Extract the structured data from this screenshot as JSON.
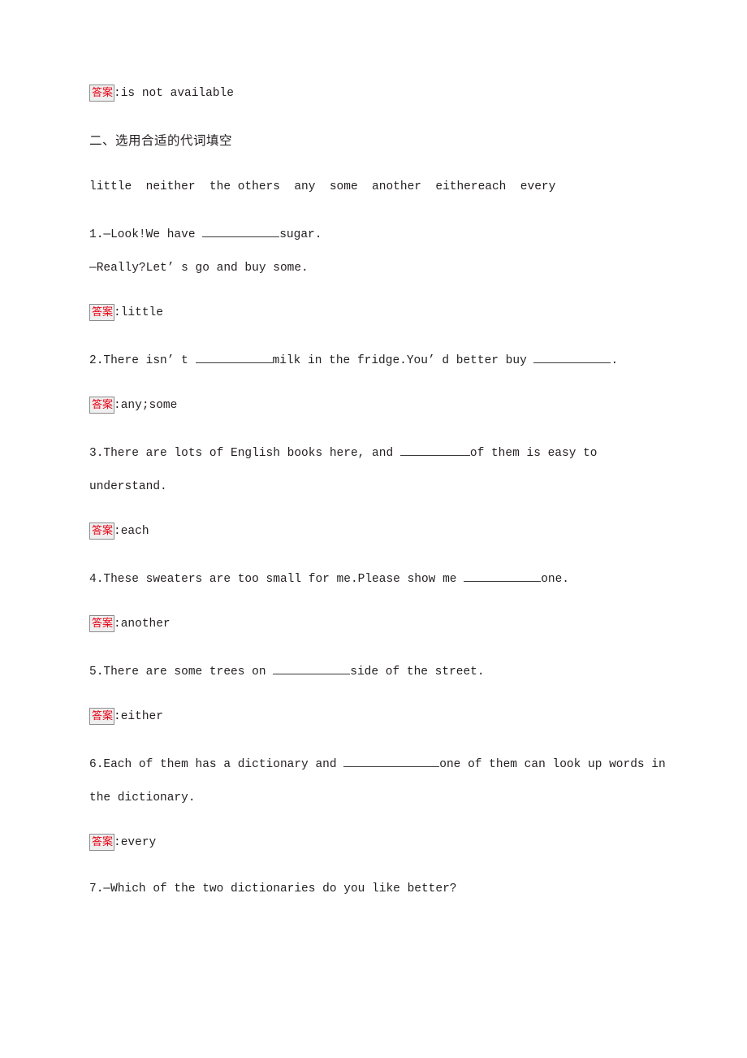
{
  "document": {
    "answer_label": "答案",
    "answer_separator": "：",
    "colors": {
      "answer_red": "#e60012",
      "badge_background": "#efefef",
      "badge_border": "#8c8c8c",
      "body_text": "#231f20"
    }
  },
  "top_answer": {
    "label": "答案",
    "colon": ":",
    "text": "is not available"
  },
  "section": {
    "heading": "二、选用合适的代词填空",
    "word_bank": "little  neither  the others  any  some  another  eithereach  every"
  },
  "questions": [
    {
      "number": "1",
      "lines": [
        {
          "before": "1.—Look!We have ",
          "blank": "md",
          "after": "sugar."
        },
        {
          "before": "—Really?Let’ s go and buy some.",
          "blank": null,
          "after": ""
        }
      ],
      "answer": {
        "label": "答案",
        "colon": ":",
        "text": "little"
      }
    },
    {
      "number": "2",
      "lines": [
        {
          "before": "2.There isn’ t ",
          "blank": "md",
          "after": "milk in the fridge.You’ d better buy ",
          "blank2": "md",
          "after2": "."
        }
      ],
      "answer": {
        "label": "答案",
        "colon": ":",
        "text": "any;some"
      }
    },
    {
      "number": "3",
      "lines": [
        {
          "before": "3.There are lots of English books here, and ",
          "blank": "sm",
          "after": "of them is easy to"
        },
        {
          "before": "understand.",
          "blank": null,
          "after": ""
        }
      ],
      "answer": {
        "label": "答案",
        "colon": ":",
        "text": "each"
      }
    },
    {
      "number": "4",
      "lines": [
        {
          "before": "4.These sweaters are too small for me.Please show me ",
          "blank": "md",
          "after": "one."
        }
      ],
      "answer": {
        "label": "答案",
        "colon": ":",
        "text": "another"
      }
    },
    {
      "number": "5",
      "lines": [
        {
          "before": "5.There are some trees on ",
          "blank": "md",
          "after": "side of the street."
        }
      ],
      "answer": {
        "label": "答案",
        "colon": ":",
        "text": "either"
      }
    },
    {
      "number": "6",
      "lines": [
        {
          "before": "6.Each of them has a dictionary and ",
          "blank": "lg",
          "after": "one of them can look up words in"
        },
        {
          "before": "the dictionary.",
          "blank": null,
          "after": ""
        }
      ],
      "answer": {
        "label": "答案",
        "colon": ":",
        "text": "every"
      }
    },
    {
      "number": "7",
      "lines": [
        {
          "before": "7.—Which of the two dictionaries do you like better?",
          "blank": null,
          "after": ""
        }
      ],
      "answer": null
    }
  ]
}
